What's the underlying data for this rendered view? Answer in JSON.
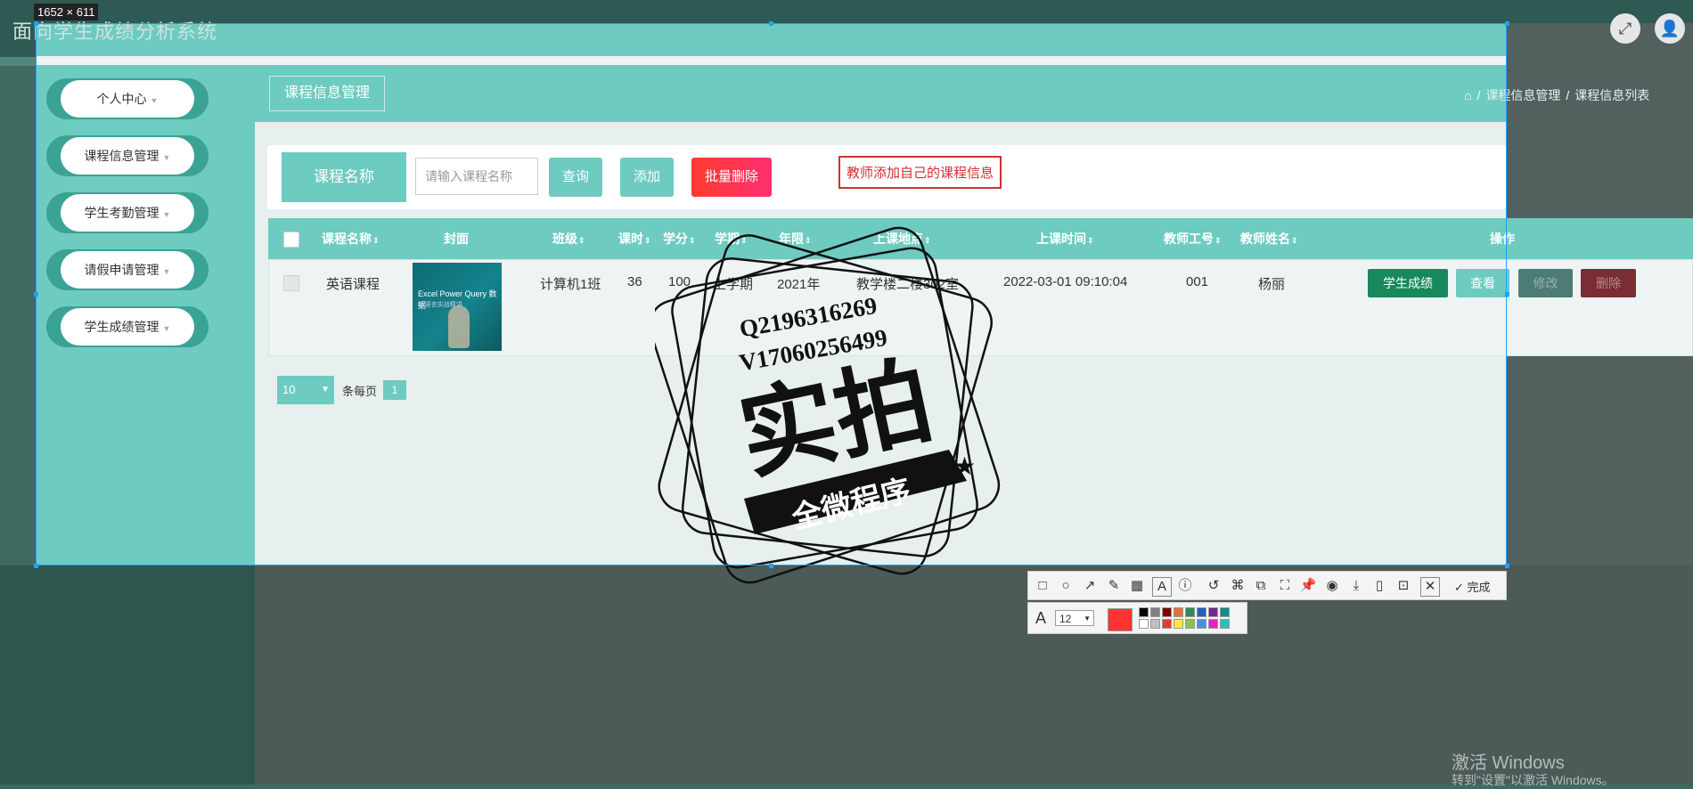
{
  "screenshot_tool": {
    "size_label": "1652 × 611",
    "done_label": "完成",
    "font_size": "12",
    "current_color": "#ff3333",
    "palette_row1": [
      "#000000",
      "#808080",
      "#800000",
      "#e07040",
      "#2e8b57",
      "#1f5fbf",
      "#6a2c91",
      "#138a8a"
    ],
    "palette_row2": [
      "#ffffff",
      "#c0c0c0",
      "#e53935",
      "#ffeb3b",
      "#8bc34a",
      "#4a90e2",
      "#e91ec4",
      "#22c1c3"
    ],
    "tools": [
      "rect-icon",
      "circle-icon",
      "arrow-icon",
      "pen-icon",
      "mosaic-icon",
      "text-icon",
      "number-icon",
      "undo-icon",
      "pin-icon",
      "ocr-icon",
      "scroll-icon",
      "pin-top-icon",
      "record-icon",
      "download-icon",
      "copy-icon",
      "save-icon",
      "cancel-icon"
    ]
  },
  "app": {
    "title": "面向学生成绩分析系统"
  },
  "sidebar": {
    "items": [
      {
        "label": "个人中心"
      },
      {
        "label": "课程信息管理"
      },
      {
        "label": "学生考勤管理"
      },
      {
        "label": "请假申请管理"
      },
      {
        "label": "学生成绩管理"
      }
    ]
  },
  "header": {
    "title": "课程信息管理",
    "breadcrumb": [
      "课程信息管理",
      "课程信息列表"
    ]
  },
  "filter": {
    "label": "课程名称",
    "placeholder": "请输入课程名称",
    "query": "查询",
    "add": "添加",
    "batch_delete": "批量删除"
  },
  "note": "教师添加自己的课程信息",
  "table": {
    "columns": [
      "课程名称",
      "封面",
      "班级",
      "课时",
      "学分",
      "学期",
      "年限",
      "上课地点",
      "上课时间",
      "教师工号",
      "教师姓名",
      "操作"
    ],
    "rows": [
      {
        "course": "英语课程",
        "cover_title": "Excel Power Query 数据",
        "cover_sub": "M 语言实战精讲",
        "class": "计算机1班",
        "hours": "36",
        "credits": "100",
        "term": "上学期",
        "year": "2021年",
        "place": "教学楼二楼302室",
        "time": "2022-03-01 09:10:04",
        "teacher_id": "001",
        "teacher_name": "杨丽",
        "actions": [
          "学生成绩",
          "查看",
          "修改",
          "删除"
        ]
      }
    ]
  },
  "pager": {
    "page_size": "10",
    "per_page_label": "条每页",
    "current": "1"
  },
  "watermark": {
    "line1": "Q2196316269",
    "line2": "V17060256499",
    "big": "实拍",
    "ribbon": "全微程序"
  },
  "windows": {
    "activate": "激活 Windows",
    "hint": "转到\"设置\"以激活 Windows。"
  }
}
